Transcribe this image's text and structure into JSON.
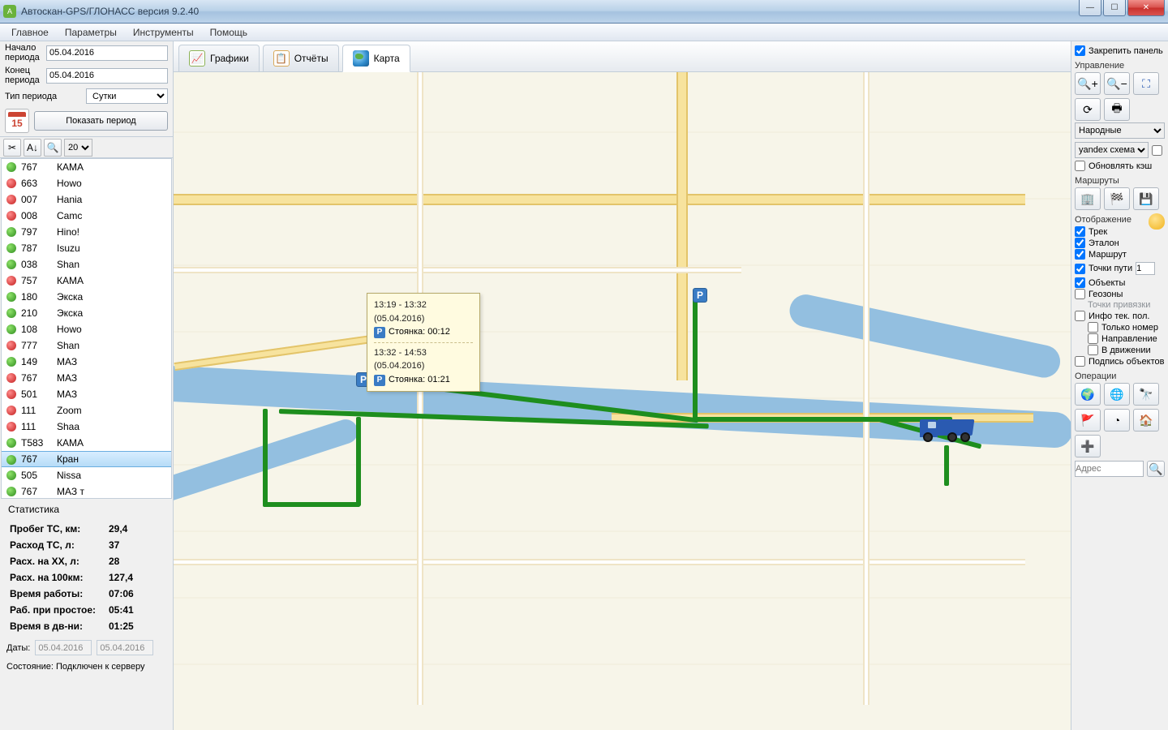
{
  "window": {
    "title": "Автоскан-GPS/ГЛОНАСС версия 9.2.40"
  },
  "menu": {
    "main": "Главное",
    "params": "Параметры",
    "tools": "Инструменты",
    "help": "Помощь"
  },
  "period": {
    "start_label": "Начало периода",
    "start": "05.04.2016",
    "end_label": "Конец периода",
    "end": "05.04.2016",
    "type_label": "Тип периода",
    "type": "Сутки",
    "calendar_day": "15",
    "show_btn": "Показать период",
    "zoom_select": "20"
  },
  "tabs": {
    "graphs": "Графики",
    "reports": "Отчёты",
    "map": "Карта"
  },
  "vehicles": [
    {
      "c": "green",
      "num": "767",
      "name": "КАМА"
    },
    {
      "c": "red",
      "num": "663",
      "name": "Howo"
    },
    {
      "c": "red",
      "num": "007",
      "name": "Hania"
    },
    {
      "c": "red",
      "num": "008",
      "name": "Camc"
    },
    {
      "c": "green",
      "num": "797",
      "name": "Hino!"
    },
    {
      "c": "green",
      "num": "787",
      "name": "Isuzu"
    },
    {
      "c": "green",
      "num": "038",
      "name": "Shan"
    },
    {
      "c": "red",
      "num": "757",
      "name": "КАМА"
    },
    {
      "c": "green",
      "num": "180",
      "name": "Экска"
    },
    {
      "c": "green",
      "num": "210",
      "name": "Экска"
    },
    {
      "c": "green",
      "num": "108",
      "name": "Howo"
    },
    {
      "c": "red",
      "num": "777",
      "name": "Shan"
    },
    {
      "c": "green",
      "num": "149",
      "name": "МАЗ"
    },
    {
      "c": "red",
      "num": "767",
      "name": "МАЗ"
    },
    {
      "c": "red",
      "num": "501",
      "name": "МАЗ"
    },
    {
      "c": "red",
      "num": "111",
      "name": "Zoom"
    },
    {
      "c": "red",
      "num": "111",
      "name": "Shaa"
    },
    {
      "c": "green",
      "num": "Т583",
      "name": "КАМА"
    },
    {
      "c": "green",
      "num": "767",
      "name": "Кран",
      "selected": true
    },
    {
      "c": "green",
      "num": "505",
      "name": "Nissa"
    },
    {
      "c": "green",
      "num": "767",
      "name": "МАЗ т"
    }
  ],
  "stats": {
    "title": "Статистика",
    "rows": [
      {
        "k": "Пробег ТС, км:",
        "v": "29,4"
      },
      {
        "k": "Расход ТС, л:",
        "v": "37"
      },
      {
        "k": "Расх. на ХХ, л:",
        "v": "28"
      },
      {
        "k": "Расх. на 100км:",
        "v": "127,4"
      },
      {
        "k": "Время работы:",
        "v": "07:06"
      },
      {
        "k": "Раб. при простое:",
        "v": "05:41"
      },
      {
        "k": "Время в дв-ни:",
        "v": "01:25"
      }
    ]
  },
  "dates": {
    "label": "Даты:",
    "d1": "05.04.2016",
    "d2": "05.04.2016"
  },
  "status": {
    "label": "Состояние:",
    "value": "Подключен к серверу"
  },
  "tooltip": {
    "l1_time": "13:19 - 13:32 (05.04.2016)",
    "l1_text": "Стоянка: 00:12",
    "l2_time": "13:32 - 14:53 (05.04.2016)",
    "l2_text": "Стоянка: 01:21"
  },
  "right": {
    "pin": "Закрепить панель",
    "control": "Управление",
    "layer_sel": "Народные",
    "tiles_sel": "yandex схема",
    "refresh_cache": "Обновлять кэш",
    "routes": "Маршруты",
    "display": "Отображение",
    "track": "Трек",
    "etalon": "Эталон",
    "route": "Маршрут",
    "waypoints": "Точки пути",
    "waypoints_n": "1",
    "objects": "Объекты",
    "geozones": "Геозоны",
    "anchor_points": "Точки привязки",
    "cur_info": "Инфо тек. пол.",
    "only_number": "Только номер",
    "direction": "Направление",
    "moving": "В движении",
    "obj_labels": "Подпись объектов",
    "ops": "Операции",
    "addr": "Адрес"
  }
}
